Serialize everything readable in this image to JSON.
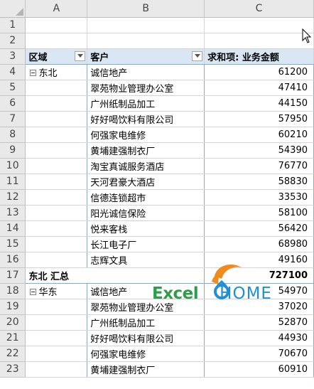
{
  "sheet": {
    "columns": [
      "A",
      "B",
      "C"
    ],
    "row_numbers": [
      "1",
      "2",
      "3",
      "4",
      "5",
      "6",
      "7",
      "8",
      "9",
      "10",
      "11",
      "12",
      "13",
      "14",
      "15",
      "16",
      "17",
      "18",
      "19",
      "20",
      "21",
      "22",
      "23"
    ]
  },
  "pivot": {
    "headers": {
      "region": "区域",
      "customer": "客户",
      "sum": "求和项: 业务金额"
    },
    "rows": [
      {
        "region": "东北",
        "customer": "诚信地产",
        "amount": "61200"
      },
      {
        "region": "",
        "customer": "翠苑物业管理办公室",
        "amount": "47410"
      },
      {
        "region": "",
        "customer": "广州纸制品加工",
        "amount": "44150"
      },
      {
        "region": "",
        "customer": "好好喝饮料有限公司",
        "amount": "57950"
      },
      {
        "region": "",
        "customer": "何强家电维修",
        "amount": "60210"
      },
      {
        "region": "",
        "customer": "黄埔建强制衣厂",
        "amount": "54390"
      },
      {
        "region": "",
        "customer": "淘宝真诚服务酒店",
        "amount": "76770"
      },
      {
        "region": "",
        "customer": "天河君豪大酒店",
        "amount": "58830"
      },
      {
        "region": "",
        "customer": "信德连锁超市",
        "amount": "33530"
      },
      {
        "region": "",
        "customer": "阳光诚信保险",
        "amount": "58100"
      },
      {
        "region": "",
        "customer": "悦来客栈",
        "amount": "56420"
      },
      {
        "region": "",
        "customer": "长江电子厂",
        "amount": "68980"
      },
      {
        "region": "",
        "customer": "志辉文具",
        "amount": "49160"
      }
    ],
    "subtotal": {
      "label": "东北 汇总",
      "amount": "727100"
    },
    "rows2": [
      {
        "region": "华东",
        "customer": "诚信地产",
        "amount": "54970"
      },
      {
        "region": "",
        "customer": "翠苑物业管理办公室",
        "amount": "37020"
      },
      {
        "region": "",
        "customer": "广州纸制品加工",
        "amount": "52870"
      },
      {
        "region": "",
        "customer": "好好喝饮料有限公司",
        "amount": "44930"
      },
      {
        "region": "",
        "customer": "何强家电维修",
        "amount": "70670"
      },
      {
        "region": "",
        "customer": "黄埔建强制衣厂",
        "amount": "60910"
      }
    ]
  },
  "watermark": {
    "part1": "Excel",
    "part2": "HOME"
  },
  "colors": {
    "header_fill": "#d9e6f4",
    "logo_green": "#2e9d49",
    "logo_blue": "#1f8fd6",
    "logo_orange": "#f08a1c"
  }
}
